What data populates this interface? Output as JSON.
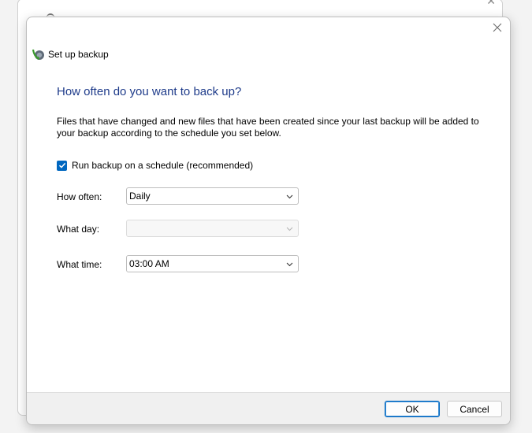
{
  "dialog": {
    "title": "Set up backup",
    "heading": "How often do you want to back up?",
    "description": "Files that have changed and new files that have been created since your last backup will be added to your backup according to the schedule you set below.",
    "schedule_checkbox": {
      "label": "Run backup on a schedule (recommended)",
      "checked": true
    },
    "fields": {
      "how_often": {
        "label": "How often:",
        "value": "Daily"
      },
      "what_day": {
        "label": "What day:",
        "value": ""
      },
      "what_time": {
        "label": "What time:",
        "value": "03:00 AM"
      }
    },
    "buttons": {
      "ok": "OK",
      "cancel": "Cancel"
    }
  },
  "icons": [
    "close-icon",
    "backup-app-icon",
    "checkmark-icon",
    "chevron-down-icon"
  ],
  "colors": {
    "heading": "#1e3b8a",
    "accent": "#0067c0"
  }
}
